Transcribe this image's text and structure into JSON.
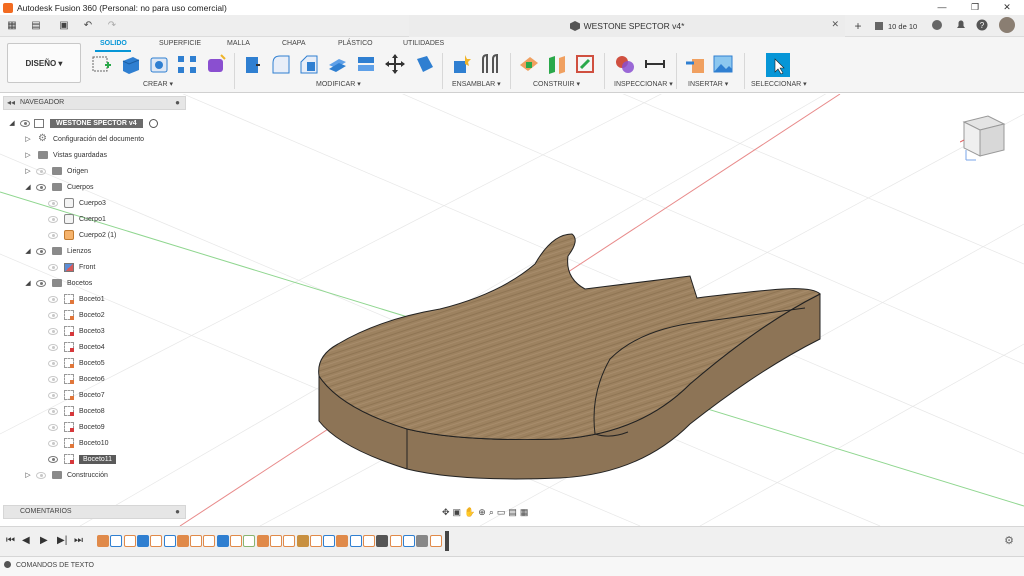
{
  "window": {
    "title": "Autodesk Fusion 360 (Personal: no para uso comercial)",
    "minimize": "—",
    "maximize": "❐",
    "close": "✕"
  },
  "qat": {
    "grid": "▦",
    "file": "▤",
    "save": "▣",
    "undo": "↶",
    "redo": "↷"
  },
  "document": {
    "title": "WESTONE SPECTOR v4*",
    "close": "✕",
    "new_tab": "+",
    "version": "10 de 10"
  },
  "ribbon": {
    "workspace": "DISEÑO ▾",
    "tabs": [
      "SOLIDO",
      "SUPERFICIE",
      "MALLA",
      "CHAPA",
      "PLÁSTICO",
      "UTILIDADES"
    ],
    "active_tab": "SOLIDO",
    "groups": [
      "CREAR ▾",
      "MODIFICAR ▾",
      "ENSAMBLAR ▾",
      "CONSTRUIR ▾",
      "INSPECCIONAR ▾",
      "INSERTAR ▾",
      "SELECCIONAR ▾"
    ]
  },
  "browser": {
    "title": "NAVEGADOR",
    "root": "WESTONE SPECTOR v4",
    "nodes": [
      {
        "label": "Configuración del documento"
      },
      {
        "label": "Vistas guardadas"
      },
      {
        "label": "Origen"
      },
      {
        "label": "Cuerpos"
      },
      {
        "label": "Cuerpo3"
      },
      {
        "label": "Cuerpo1"
      },
      {
        "label": "Cuerpo2 (1)"
      },
      {
        "label": "Lienzos"
      },
      {
        "label": "Front"
      },
      {
        "label": "Bocetos"
      },
      {
        "label": "Boceto1"
      },
      {
        "label": "Boceto2"
      },
      {
        "label": "Boceto3"
      },
      {
        "label": "Boceto4"
      },
      {
        "label": "Boceto5"
      },
      {
        "label": "Boceto6"
      },
      {
        "label": "Boceto7"
      },
      {
        "label": "Boceto8"
      },
      {
        "label": "Boceto9"
      },
      {
        "label": "Boceto10"
      },
      {
        "label": "Boceto11"
      },
      {
        "label": "Construcción"
      }
    ]
  },
  "comments": {
    "title": "COMENTARIOS"
  },
  "command_bar": {
    "title": "COMANDOS DE TEXTO"
  },
  "colors": {
    "accent": "#0696d7",
    "wood": "#a88a6a",
    "grid_red": "#e88a8a",
    "grid_green": "#8fd68f"
  },
  "viewcube": {
    "face": "FRONT"
  }
}
